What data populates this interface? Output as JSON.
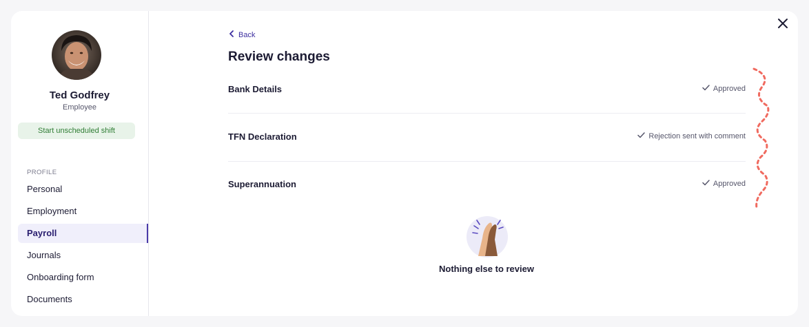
{
  "profile": {
    "name": "Ted Godfrey",
    "role": "Employee",
    "shift_button": "Start unscheduled shift"
  },
  "sidebar": {
    "section_label": "PROFILE",
    "items": [
      {
        "label": "Personal"
      },
      {
        "label": "Employment"
      },
      {
        "label": "Payroll"
      },
      {
        "label": "Journals"
      },
      {
        "label": "Onboarding form"
      },
      {
        "label": "Documents"
      }
    ],
    "active": "Payroll"
  },
  "main": {
    "back_label": "Back",
    "title": "Review changes",
    "rows": [
      {
        "label": "Bank Details",
        "status": "Approved"
      },
      {
        "label": "TFN Declaration",
        "status": "Rejection sent with comment"
      },
      {
        "label": "Superannuation",
        "status": "Approved"
      }
    ],
    "empty_state": "Nothing else to review"
  },
  "icons": {
    "back": "chevron-left-icon",
    "close": "close-icon",
    "status": "check-icon",
    "illustration": "high-five-icon"
  },
  "colors": {
    "accent": "#4a3aa8",
    "success_bg": "#e8f3e9",
    "success_text": "#2f7d34",
    "decoration": "#f06a5f"
  }
}
